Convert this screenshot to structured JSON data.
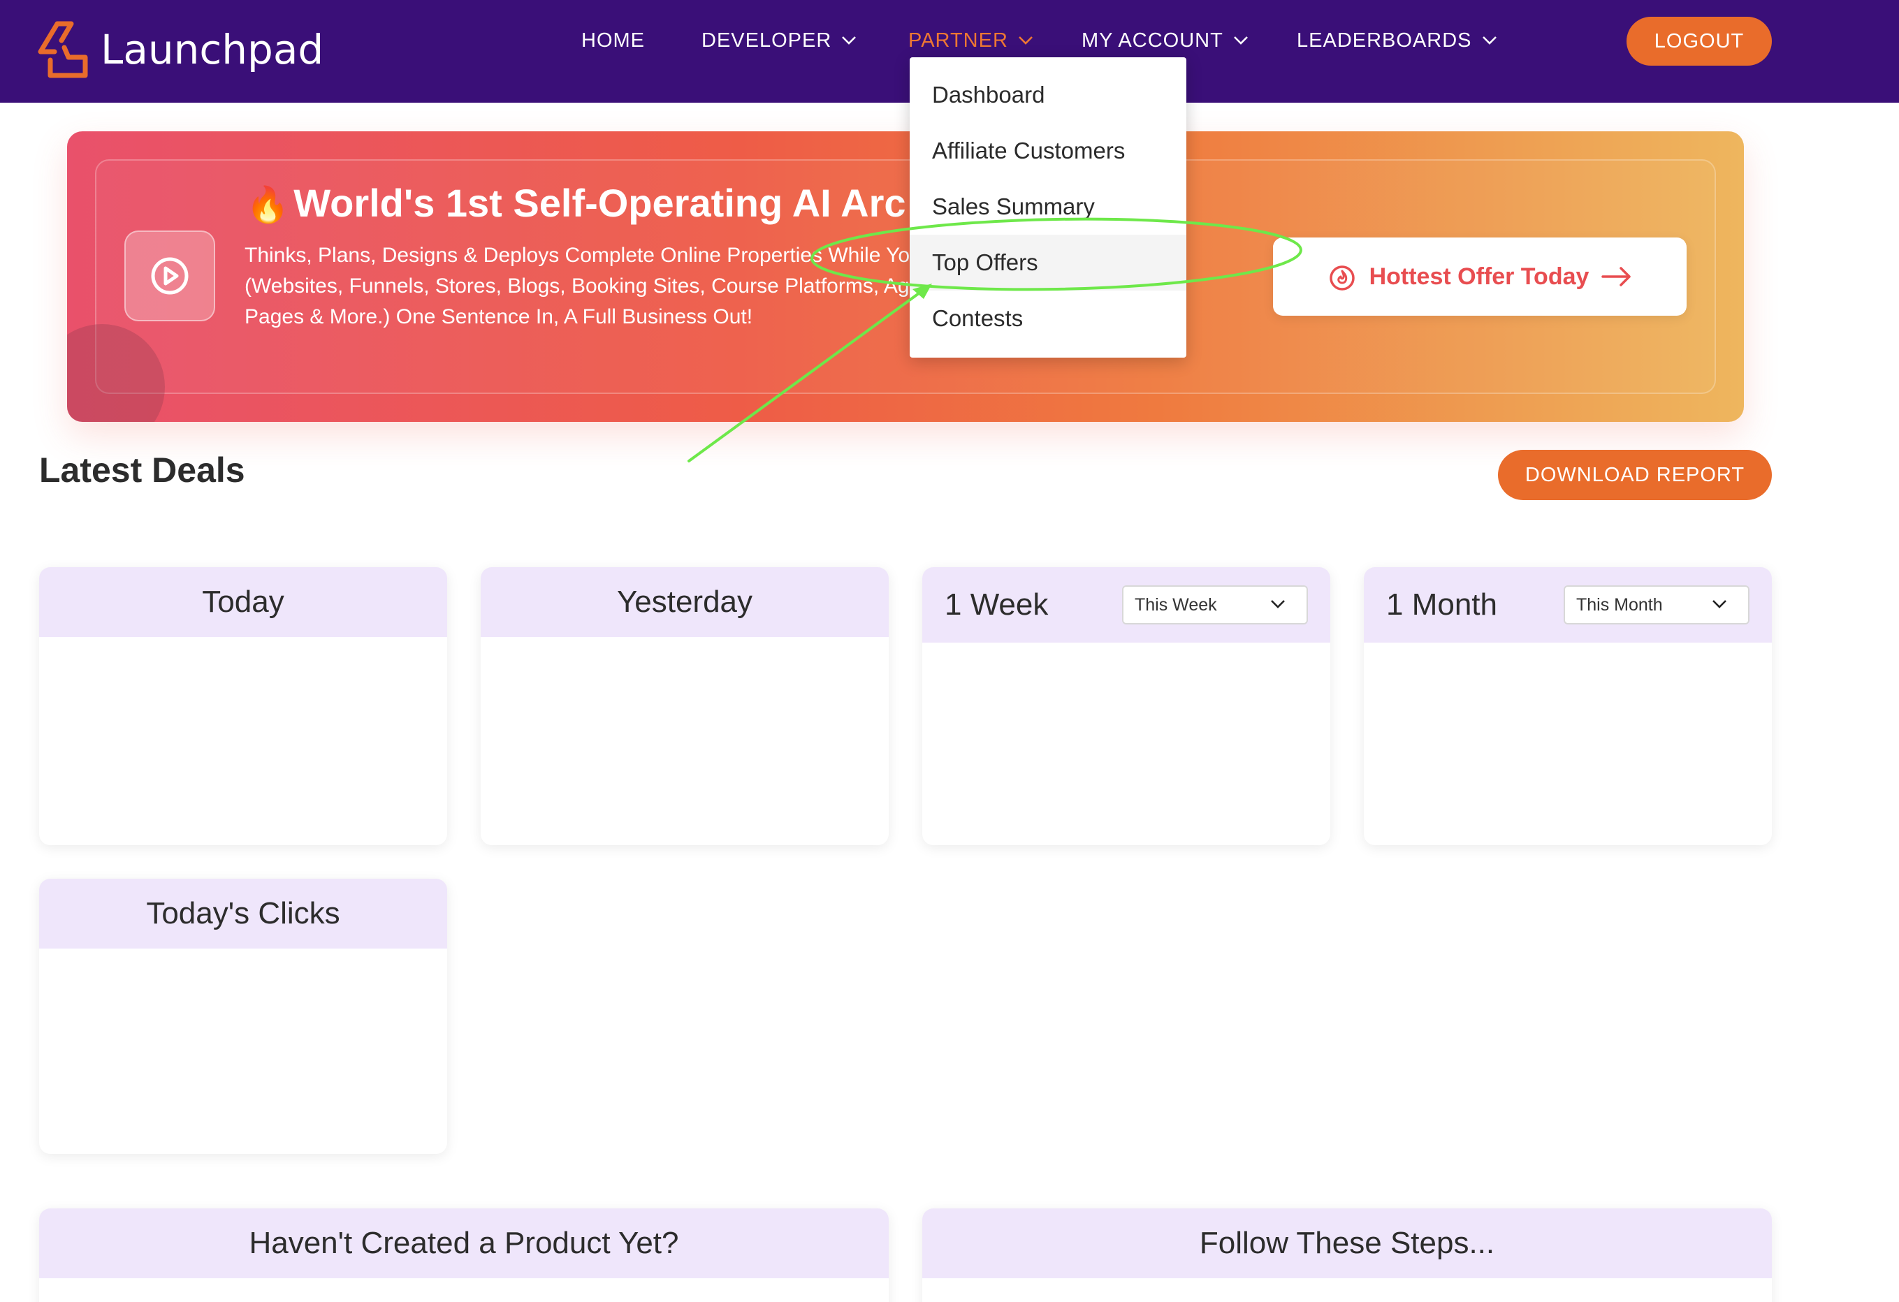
{
  "brand": {
    "name": "Launchpad"
  },
  "nav": {
    "items": [
      {
        "label": "HOME",
        "has_dropdown": false
      },
      {
        "label": "DEVELOPER",
        "has_dropdown": true
      },
      {
        "label": "PARTNER",
        "has_dropdown": true,
        "active": true
      },
      {
        "label": "MY ACCOUNT",
        "has_dropdown": true
      },
      {
        "label": "LEADERBOARDS",
        "has_dropdown": true
      }
    ],
    "logout_label": "LOGOUT"
  },
  "partner_menu": {
    "items": [
      "Dashboard",
      "Affiliate Customers",
      "Sales Summary",
      "Top Offers",
      "Contests"
    ],
    "highlighted": "Top Offers"
  },
  "banner": {
    "icon": "fire-emoji",
    "title": "World's 1st Self-Operating AI Arc",
    "description": "Thinks, Plans, Designs & Deploys Complete Online Properties While You Watch (Websites, Funnels, Stores, Blogs, Booking Sites, Course Platforms, Agency Pages & More.) One Sentence In, A Full Business Out!",
    "cta_label": "Hottest Offer Today",
    "cta_icon": "flame-icon"
  },
  "latest_deals": {
    "title": "Latest Deals",
    "download_label": "DOWNLOAD REPORT",
    "cards": {
      "today": "Today",
      "yesterday": "Yesterday",
      "week": {
        "title": "1 Week",
        "select": "This Week"
      },
      "month": {
        "title": "1 Month",
        "select": "This Month"
      },
      "clicks": "Today's Clicks"
    }
  },
  "bottom_cards": {
    "left": "Haven't Created a Product Yet?",
    "right": "Follow These Steps..."
  },
  "colors": {
    "nav_bg": "#3a0f78",
    "accent_orange": "#e96c2b",
    "card_header": "#efe6fb",
    "annotation": "#6ee84a"
  }
}
